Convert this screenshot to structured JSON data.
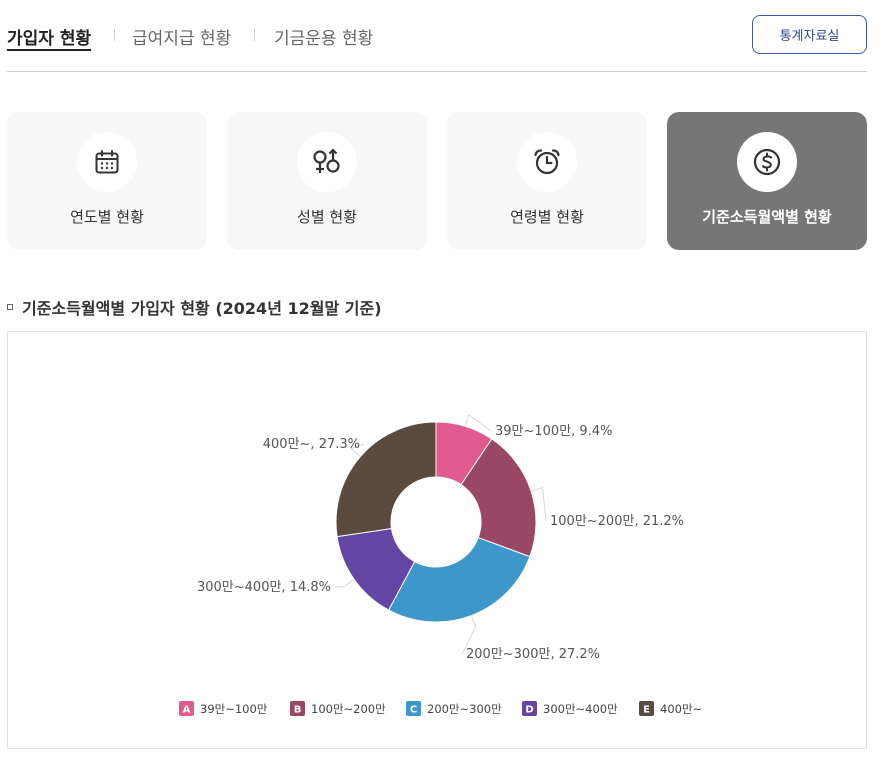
{
  "tabs": [
    {
      "label": "가입자 현황",
      "active": true
    },
    {
      "label": "급여지급 현황",
      "active": false
    },
    {
      "label": "기금운용 현황",
      "active": false
    }
  ],
  "stats_button": "통계자료실",
  "cards": [
    {
      "label": "연도별 현황",
      "icon": "calendar-icon",
      "active": false
    },
    {
      "label": "성별 현황",
      "icon": "gender-icon",
      "active": false
    },
    {
      "label": "연령별 현황",
      "icon": "alarm-clock-icon",
      "active": false
    },
    {
      "label": "기준소득월액별 현황",
      "icon": "dollar-coin-icon",
      "active": true
    }
  ],
  "section_title": "기준소득월액별 가입자 현황 (2024년 12월말 기준)",
  "colors": {
    "accent_button": "#3e5aa8",
    "active_card": "#767676"
  },
  "chart_data": {
    "type": "pie",
    "donut": true,
    "categories": [
      "39만~100만",
      "100만~200만",
      "200만~300만",
      "300만~400만",
      "400만~"
    ],
    "values": [
      9.4,
      21.2,
      27.2,
      14.8,
      27.3
    ],
    "unit": "%",
    "data_labels": [
      "39만~100만, 9.4%",
      "100만~200만, 21.2%",
      "200만~300만, 27.2%",
      "300만~400만, 14.8%",
      "400만~, 27.3%"
    ],
    "colors": [
      "#e05a8e",
      "#994765",
      "#3d97cb",
      "#6345a4",
      "#5b4a3e"
    ],
    "legend_letters": [
      "A",
      "B",
      "C",
      "D",
      "E"
    ],
    "legend_placement": "bottom"
  }
}
